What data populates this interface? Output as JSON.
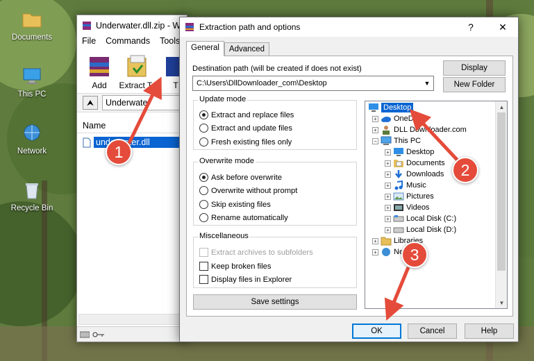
{
  "desktop": {
    "icons": [
      {
        "label": "Documents",
        "icon": "folder-icon"
      },
      {
        "label": "This PC",
        "icon": "computer-icon"
      },
      {
        "label": "Network",
        "icon": "network-icon"
      },
      {
        "label": "Recycle Bin",
        "icon": "recycle-bin-icon"
      }
    ]
  },
  "winrar": {
    "title": "Underwater.dll.zip - W",
    "menu": [
      "File",
      "Commands",
      "Tools"
    ],
    "toolbar": {
      "add": "Add",
      "extract_to": "Extract To",
      "test": "T"
    },
    "address": "Underwater",
    "column_name": "Name",
    "file": "underwater.dll"
  },
  "dialog": {
    "title": "Extraction path and options",
    "help": "?",
    "close": "✕",
    "tabs": [
      "General",
      "Advanced"
    ],
    "dest_label": "Destination path (will be created if does not exist)",
    "dest_value": "C:\\Users\\DllDownloader_com\\Desktop",
    "display_btn": "Display",
    "new_folder_btn": "New Folder",
    "update_mode": {
      "title": "Update mode",
      "options": [
        "Extract and replace files",
        "Extract and update files",
        "Fresh existing files only"
      ],
      "selected": 0
    },
    "overwrite_mode": {
      "title": "Overwrite mode",
      "options": [
        "Ask before overwrite",
        "Overwrite without prompt",
        "Skip existing files",
        "Rename automatically"
      ],
      "selected": 0
    },
    "misc": {
      "title": "Miscellaneous",
      "options": [
        "Extract archives to subfolders",
        "Keep broken files",
        "Display files in Explorer"
      ]
    },
    "save_settings": "Save settings",
    "tree": [
      {
        "label": "Desktop",
        "icon": "desktop-icon",
        "selected": true
      },
      {
        "label": "OneDrive",
        "icon": "onedrive-icon"
      },
      {
        "label": "DLL Downloader.com",
        "icon": "user-icon"
      },
      {
        "label": "This PC",
        "icon": "computer-icon"
      },
      {
        "label": "Desktop",
        "icon": "desktop-icon"
      },
      {
        "label": "Documents",
        "icon": "documents-icon"
      },
      {
        "label": "Downloads",
        "icon": "downloads-icon"
      },
      {
        "label": "Music",
        "icon": "music-icon"
      },
      {
        "label": "Pictures",
        "icon": "pictures-icon"
      },
      {
        "label": "Videos",
        "icon": "videos-icon"
      },
      {
        "label": "Local Disk (C:)",
        "icon": "drive-icon"
      },
      {
        "label": "Local Disk (D:)",
        "icon": "drive-icon"
      },
      {
        "label": "Libraries",
        "icon": "libraries-icon"
      },
      {
        "label": "Network",
        "icon": "network-icon"
      }
    ],
    "buttons": {
      "ok": "OK",
      "cancel": "Cancel",
      "help": "Help"
    }
  },
  "annotations": {
    "step1": "1",
    "step2": "2",
    "step3": "3",
    "color": "#e54b3a"
  }
}
